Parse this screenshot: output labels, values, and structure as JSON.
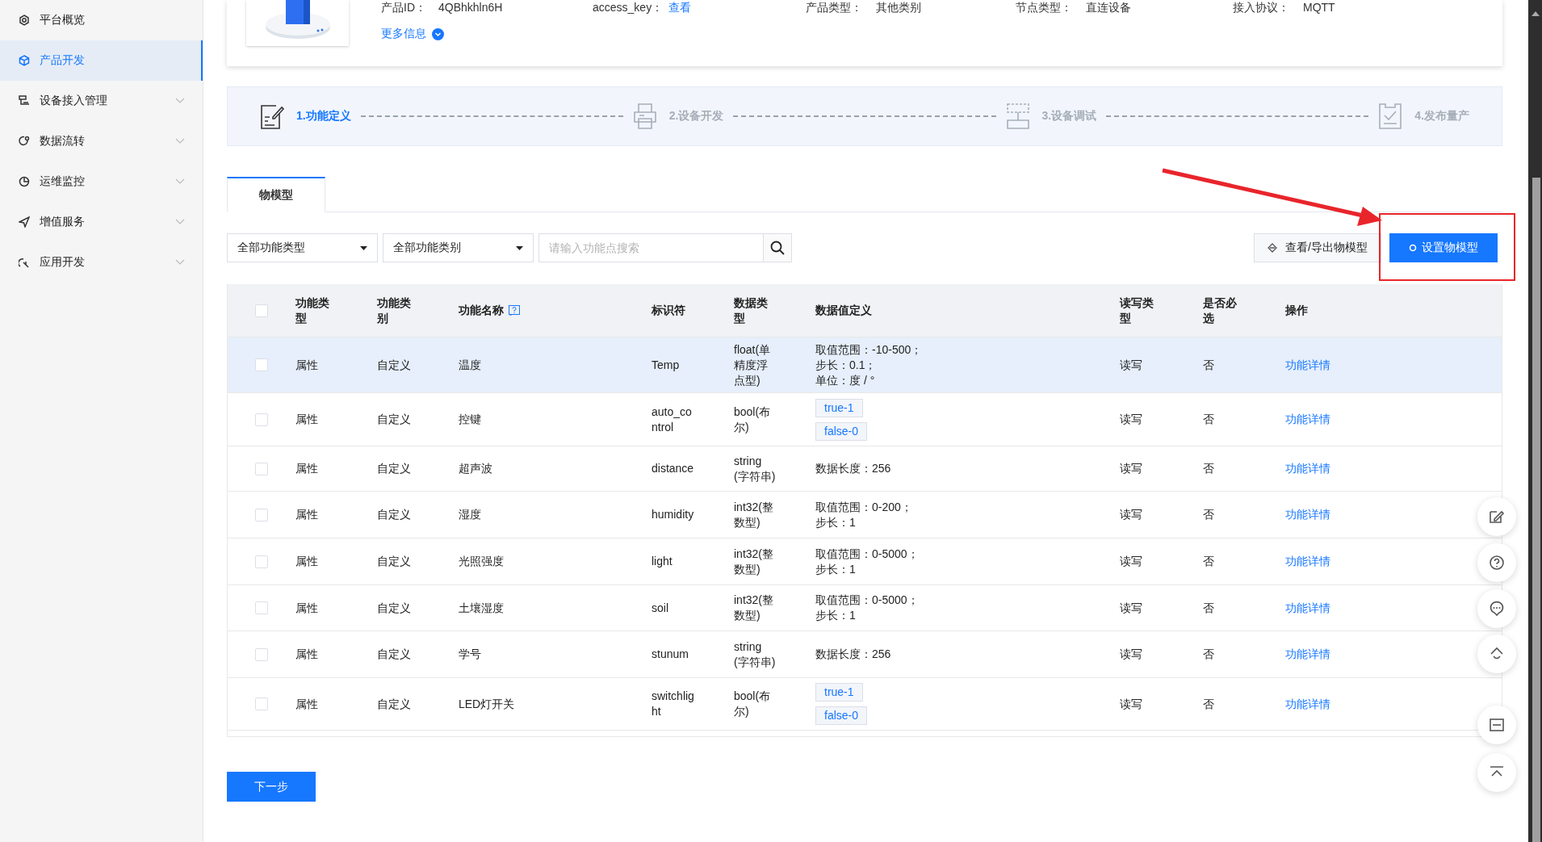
{
  "sidebar": {
    "items": [
      {
        "label": "平台概览",
        "selected": false,
        "has_submenu": false
      },
      {
        "label": "产品开发",
        "selected": true,
        "has_submenu": false
      },
      {
        "label": "设备接入管理",
        "selected": false,
        "has_submenu": true
      },
      {
        "label": "数据流转",
        "selected": false,
        "has_submenu": true
      },
      {
        "label": "运维监控",
        "selected": false,
        "has_submenu": true
      },
      {
        "label": "增值服务",
        "selected": false,
        "has_submenu": true
      },
      {
        "label": "应用开发",
        "selected": false,
        "has_submenu": true
      }
    ]
  },
  "product": {
    "fields": [
      {
        "label": "产品ID：",
        "value": "4QBhkhln6H",
        "link": false
      },
      {
        "label": "access_key：",
        "value": "查看",
        "link": true
      },
      {
        "label": "产品类型：",
        "value": "其他类别",
        "link": false
      },
      {
        "label": "节点类型：",
        "value": "直连设备",
        "link": false
      },
      {
        "label": "接入协议：",
        "value": "MQTT",
        "link": false
      }
    ],
    "more_info": "更多信息"
  },
  "steps": [
    {
      "label": "1.功能定义",
      "active": true
    },
    {
      "label": "2.设备开发",
      "active": false
    },
    {
      "label": "3.设备调试",
      "active": false
    },
    {
      "label": "4.发布量产",
      "active": false
    }
  ],
  "tabs": [
    {
      "label": "物模型",
      "selected": true
    }
  ],
  "filters": {
    "type_select": "全部功能类型",
    "category_select": "全部功能类别",
    "search": {
      "placeholder": "请输入功能点搜索"
    }
  },
  "buttons": {
    "export": "查看/导出物模型",
    "setup": "设置物模型"
  },
  "table": {
    "select_all_checked": false,
    "columns": [
      "功能类型",
      "功能类别",
      "功能名称",
      "标识符",
      "数据类型",
      "数据值定义",
      "读写类型",
      "是否必选",
      "操作"
    ],
    "rows": [
      {
        "checked": false,
        "selected": true,
        "type": "属性",
        "category": "自定义",
        "name": "温度",
        "identifier": "Temp",
        "data_type": "float(单精度浮点型)",
        "definition": {
          "kind": "lines",
          "items": [
            "取值范围：-10-500；",
            "步长：0.1；",
            "单位：度 / °"
          ]
        },
        "access": "读写",
        "required": "否",
        "action": "功能详情"
      },
      {
        "checked": false,
        "selected": false,
        "type": "属性",
        "category": "自定义",
        "name": "控键",
        "identifier": "auto_control",
        "data_type": "bool(布尔)",
        "definition": {
          "kind": "tags",
          "items": [
            "true-1",
            "false-0"
          ]
        },
        "access": "读写",
        "required": "否",
        "action": "功能详情"
      },
      {
        "checked": false,
        "selected": false,
        "type": "属性",
        "category": "自定义",
        "name": "超声波",
        "identifier": "distance",
        "data_type": "string(字符串)",
        "definition": {
          "kind": "lines",
          "items": [
            "数据长度：256"
          ]
        },
        "access": "读写",
        "required": "否",
        "action": "功能详情"
      },
      {
        "checked": false,
        "selected": false,
        "type": "属性",
        "category": "自定义",
        "name": "湿度",
        "identifier": "humidity",
        "data_type": "int32(整数型)",
        "definition": {
          "kind": "lines",
          "items": [
            "取值范围：0-200；",
            "步长：1"
          ]
        },
        "access": "读写",
        "required": "否",
        "action": "功能详情"
      },
      {
        "checked": false,
        "selected": false,
        "type": "属性",
        "category": "自定义",
        "name": "光照强度",
        "identifier": "light",
        "data_type": "int32(整数型)",
        "definition": {
          "kind": "lines",
          "items": [
            "取值范围：0-5000；",
            "步长：1"
          ]
        },
        "access": "读写",
        "required": "否",
        "action": "功能详情"
      },
      {
        "checked": false,
        "selected": false,
        "type": "属性",
        "category": "自定义",
        "name": "土壤湿度",
        "identifier": "soil",
        "data_type": "int32(整数型)",
        "definition": {
          "kind": "lines",
          "items": [
            "取值范围：0-5000；",
            "步长：1"
          ]
        },
        "access": "读写",
        "required": "否",
        "action": "功能详情"
      },
      {
        "checked": false,
        "selected": false,
        "type": "属性",
        "category": "自定义",
        "name": "学号",
        "identifier": "stunum",
        "data_type": "string(字符串)",
        "definition": {
          "kind": "lines",
          "items": [
            "数据长度：256"
          ]
        },
        "access": "读写",
        "required": "否",
        "action": "功能详情"
      },
      {
        "checked": false,
        "selected": false,
        "type": "属性",
        "category": "自定义",
        "name": "LED灯开关",
        "identifier": "switchlight",
        "data_type": "bool(布尔)",
        "definition": {
          "kind": "tags",
          "items": [
            "true-1",
            "false-0"
          ]
        },
        "access": "读写",
        "required": "否",
        "action": "功能详情"
      }
    ]
  },
  "next_button": "下一步"
}
